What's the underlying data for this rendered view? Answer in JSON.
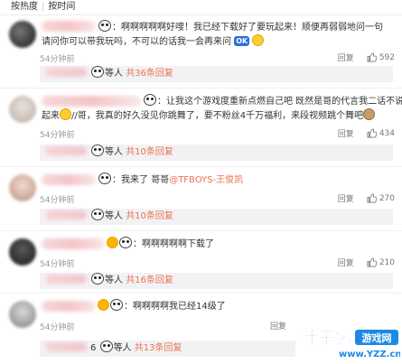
{
  "sort": {
    "hot": "按热度",
    "time": "按时间"
  },
  "comments": [
    {
      "text_line1": "：啊啊啊啊啊好嗖！我已经下载好了要玩起来！顺便再弱弱地问一句",
      "text_line2": "请问你可以带我玩吗，不可以的话我一会再来问",
      "ok": "OK",
      "time": "54分钟前",
      "reply": "回复",
      "likes": "592",
      "reply_summary": "等人",
      "reply_count": "共36条回复"
    },
    {
      "text_line1": "：让我这个游戏度重新点燃自己吧 既然是哥的代言我二话不说走",
      "text_line2": "起来",
      "text_line2b": "//哥，我真的好久没见你跳舞了，要不粉丝4千万福利，来段视频跳个舞吧",
      "time": "54分钟前",
      "reply": "回复",
      "likes": "434",
      "reply_summary": "等人",
      "reply_count": "共10条回复"
    },
    {
      "text_line1": "：我来了 哥哥",
      "mention": "@TFBOYS-王俊凯",
      "time": "54分钟前",
      "reply": "回复",
      "likes": "270",
      "reply_summary": "等人",
      "reply_count": "共10条回复"
    },
    {
      "text_line1": "：啊啊啊啊啊下载了",
      "time": "54分钟前",
      "reply": "回复",
      "likes": "210",
      "reply_summary": "等人",
      "reply_count": "共16条回复"
    },
    {
      "text_line1": "：啊啊啊啊我已经14级了",
      "time": "54分钟前",
      "reply": "回复",
      "likes": "",
      "reply_prefix": "6",
      "reply_summary": "等人",
      "reply_count": "共13条回复"
    }
  ],
  "watermark": {
    "title": "叶子猪",
    "subtitle": "游戏网",
    "url": "www.YZZ.cn"
  }
}
